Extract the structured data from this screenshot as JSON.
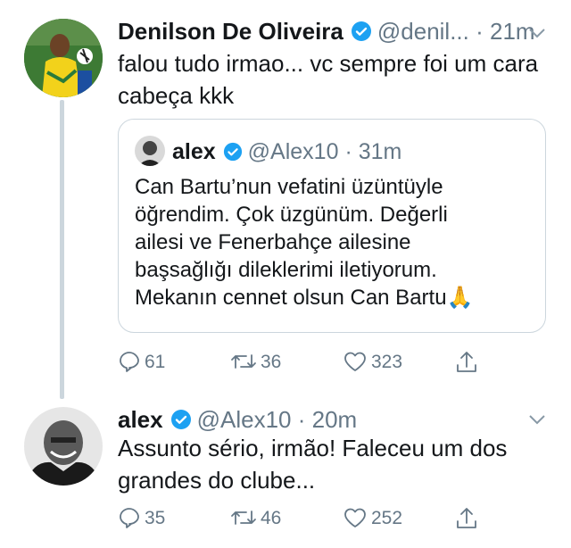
{
  "tweet1": {
    "display_name": "Denilson De Oliveira",
    "handle": "@denil...",
    "time": "· 21m",
    "text_lines": [
      "falou tudo irmao... vc sempre foi um cara",
      "cabeça kkk"
    ]
  },
  "quoted": {
    "display_name": "alex",
    "handle": "@Alex10",
    "time": "· 31m",
    "text_lines": [
      "Can Bartu’nun vefatini üzüntüyle",
      "öğrendim. Çok üzgünüm. Değerli",
      "ailesi ve Fenerbahçe ailesine",
      "başsağlığı dileklerimi iletiyorum.",
      "Mekanın cennet olsun Can Bartu"
    ],
    "emoji": "🙏"
  },
  "tweet1_actions": {
    "replies": "61",
    "retweets": "36",
    "likes": "323"
  },
  "tweet2": {
    "display_name": "alex",
    "handle": "@Alex10",
    "time": "· 20m",
    "text_lines": [
      "Assunto sério, irmão! Faleceu um dos",
      "grandes do clube..."
    ]
  },
  "tweet2_actions": {
    "replies": "35",
    "retweets": "46",
    "likes": "252"
  },
  "colors": {
    "verified": "#1da1f2",
    "muted": "#657786",
    "border": "#ccd6dd"
  }
}
